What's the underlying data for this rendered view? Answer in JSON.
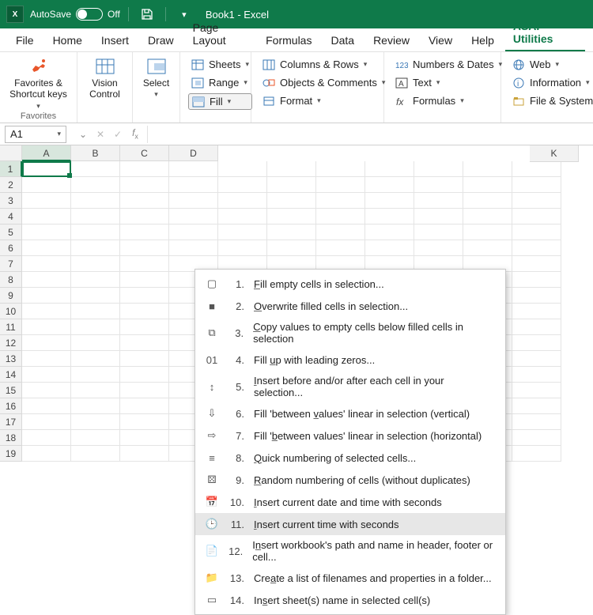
{
  "titlebar": {
    "autosave_label": "AutoSave",
    "autosave_state": "Off",
    "doc_title": "Book1 - Excel"
  },
  "tabs": [
    "File",
    "Home",
    "Insert",
    "Draw",
    "Page Layout",
    "Formulas",
    "Data",
    "Review",
    "View",
    "Help",
    "ASAP Utilities"
  ],
  "active_tab": "ASAP Utilities",
  "ribbon": {
    "favorites": {
      "big": "Favorites &\nShortcut keys",
      "group_label": "Favorites"
    },
    "vision": "Vision\nControl",
    "select": "Select",
    "col1": [
      "Sheets",
      "Range",
      "Fill"
    ],
    "col2": [
      "Columns & Rows",
      "Objects & Comments",
      "Format"
    ],
    "col3": [
      "Numbers & Dates",
      "Text",
      "Formulas"
    ],
    "col4": [
      "Web",
      "Information",
      "File & System"
    ]
  },
  "namebox": {
    "ref": "A1"
  },
  "columns": [
    "A",
    "B",
    "C",
    "D",
    "",
    "",
    "",
    "",
    "",
    "",
    "K"
  ],
  "rows_count": 19,
  "menu": {
    "items": [
      {
        "n": "1.",
        "label": "Fill empty cells in selection...",
        "u": "F"
      },
      {
        "n": "2.",
        "label": "Overwrite filled cells in selection...",
        "u": "O"
      },
      {
        "n": "3.",
        "label": "Copy values to empty cells below filled cells in selection",
        "u": "C"
      },
      {
        "n": "4.",
        "label": "Fill up with leading zeros...",
        "u": "u"
      },
      {
        "n": "5.",
        "label": "Insert before and/or after each cell in your selection...",
        "u": "I"
      },
      {
        "n": "6.",
        "label": "Fill 'between values' linear in selection (vertical)",
        "u": "v"
      },
      {
        "n": "7.",
        "label": "Fill 'between values' linear in selection (horizontal)",
        "u": "b"
      },
      {
        "n": "8.",
        "label": "Quick numbering of selected cells...",
        "u": "Q"
      },
      {
        "n": "9.",
        "label": "Random numbering of cells (without duplicates)",
        "u": "R"
      },
      {
        "n": "10.",
        "label": "Insert current date and time with seconds",
        "u": "I"
      },
      {
        "n": "11.",
        "label": "Insert current time with seconds",
        "u": "I",
        "hover": true
      },
      {
        "n": "12.",
        "label": "Insert workbook's path and name in header, footer or cell...",
        "u": "n"
      },
      {
        "n": "13.",
        "label": "Create a list of filenames and properties in a folder...",
        "u": "a"
      },
      {
        "n": "14.",
        "label": "Insert sheet(s) name in selected cell(s)",
        "u": "s"
      }
    ]
  }
}
